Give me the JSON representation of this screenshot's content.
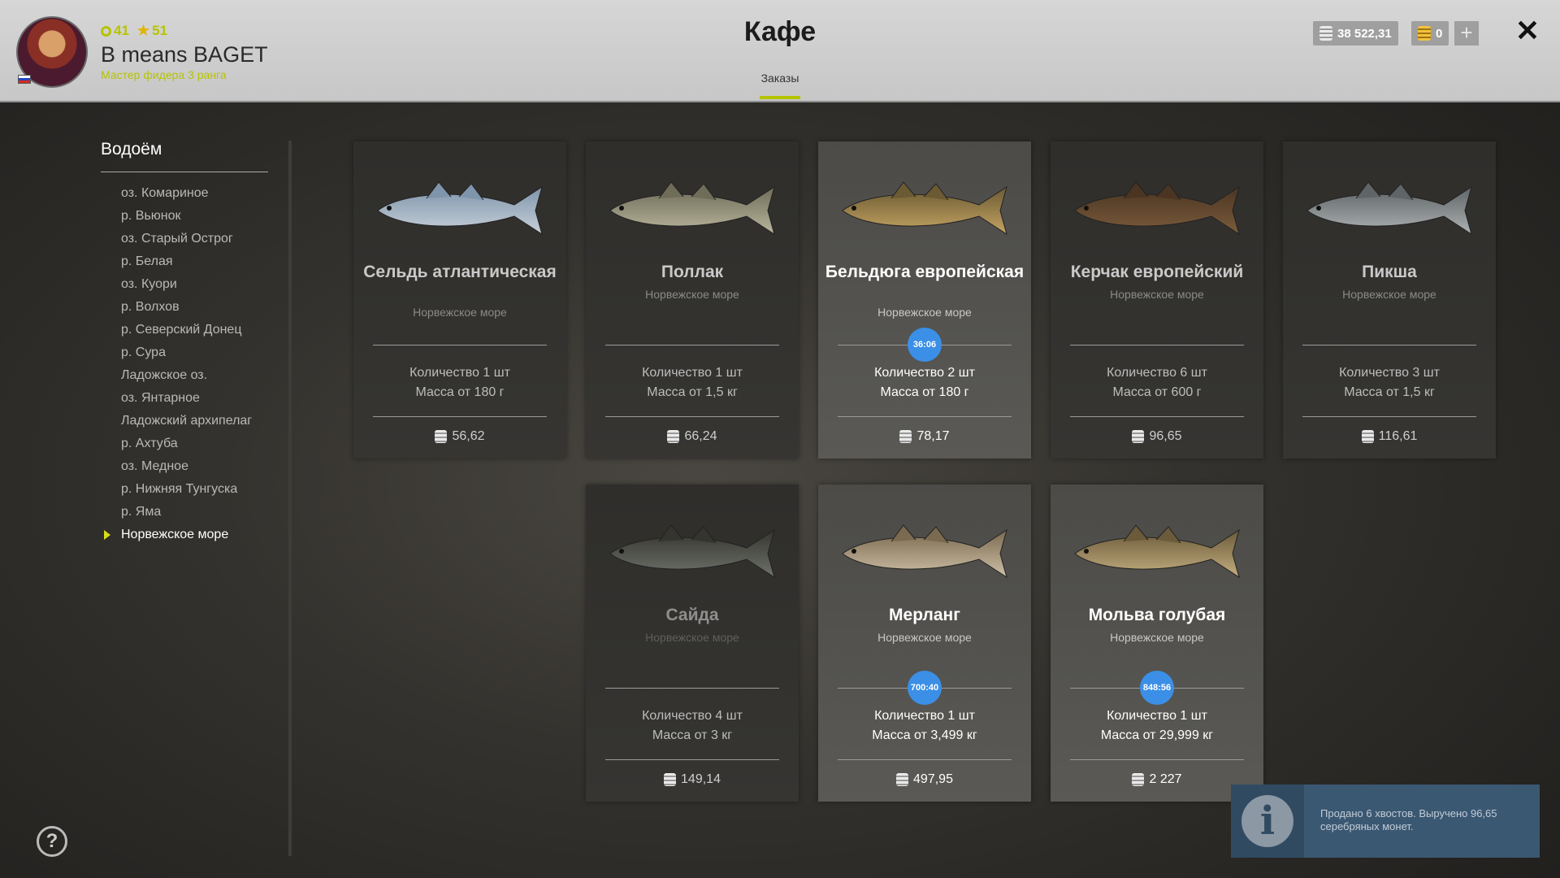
{
  "player": {
    "level": "41",
    "stars": "51",
    "name": "B means BAGET",
    "rank": "Мастер фидера 3 ранга"
  },
  "header": {
    "title": "Кафе",
    "tab": "Заказы",
    "silver": "38 522,31",
    "gold": "0"
  },
  "sidebar": {
    "title": "Водоём",
    "items": [
      "оз. Комариное",
      "р. Вьюнок",
      "оз. Старый Острог",
      "р. Белая",
      "оз. Куори",
      "р. Волхов",
      "р. Северский Донец",
      "р. Сура",
      "Ладожское оз.",
      "оз. Янтарное",
      "Ладожский архипелаг",
      "р. Ахтуба",
      "оз. Медное",
      "р. Нижняя Тунгуска",
      "р. Яма",
      "Норвежское море"
    ],
    "active_index": 15
  },
  "cards": [
    {
      "name": "Сельдь атлантическая",
      "water": "Норвежское море",
      "qty": "Количество 1 шт",
      "mass": "Масса от 180 г",
      "price": "56,62",
      "timer": ""
    },
    {
      "name": "Поллак",
      "water": "Норвежское море",
      "qty": "Количество 1 шт",
      "mass": "Масса от 1,5 кг",
      "price": "66,24",
      "timer": ""
    },
    {
      "name": "Бельдюга европейская",
      "water": "Норвежское море",
      "qty": "Количество 2 шт",
      "mass": "Масса от 180 г",
      "price": "78,17",
      "timer": "36:06"
    },
    {
      "name": "Керчак европейский",
      "water": "Норвежское море",
      "qty": "Количество 6 шт",
      "mass": "Масса от 600 г",
      "price": "96,65",
      "timer": ""
    },
    {
      "name": "Пикша",
      "water": "Норвежское море",
      "qty": "Количество 3 шт",
      "mass": "Масса от 1,5 кг",
      "price": "116,61",
      "timer": ""
    },
    {
      "name": "Сайда",
      "water": "Норвежское море",
      "qty": "Количество 4 шт",
      "mass": "Масса от 3 кг",
      "price": "149,14",
      "timer": ""
    },
    {
      "name": "Мерланг",
      "water": "Норвежское море",
      "qty": "Количество 1 шт",
      "mass": "Масса от 3,499 кг",
      "price": "497,95",
      "timer": "700:40"
    },
    {
      "name": "Мольва голубая",
      "water": "Норвежское море",
      "qty": "Количество 1 шт",
      "mass": "Масса от 29,999 кг",
      "price": "2 227",
      "timer": "848:56"
    }
  ],
  "notification": {
    "text": "Продано 6 хвостов. Выручено 96,65 серебряных монет."
  },
  "colors": {
    "accent": "#b6c400",
    "timer": "#3b8fe6"
  }
}
